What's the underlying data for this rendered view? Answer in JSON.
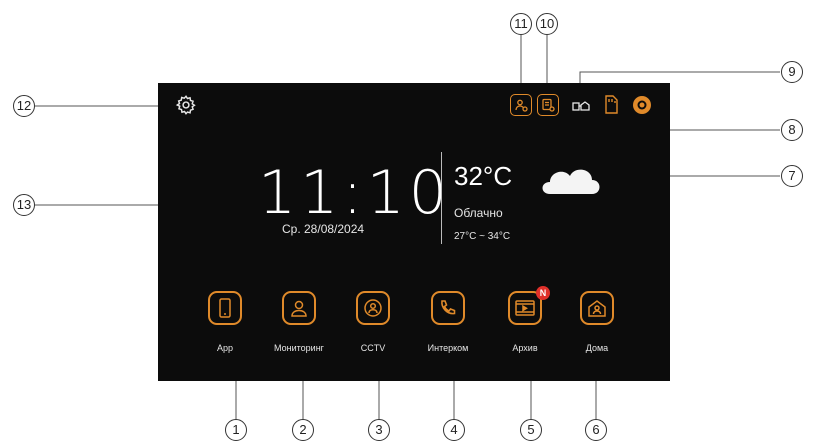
{
  "clock": {
    "time": "11:10",
    "date": "Ср. 28/08/2024"
  },
  "weather": {
    "temperature": "32°C",
    "condition": "Облачно",
    "range": "27°C ~ 34°C",
    "icon": "cloud-icon"
  },
  "apps": [
    {
      "label": "App",
      "icon": "smartphone-icon"
    },
    {
      "label": "Мониторинг",
      "icon": "user-icon"
    },
    {
      "label": "CCTV",
      "icon": "camera-person-icon"
    },
    {
      "label": "Интерком",
      "icon": "phone-icon"
    },
    {
      "label": "Архив",
      "icon": "video-play-icon",
      "badge": "N"
    },
    {
      "label": "Дома",
      "icon": "home-person-icon"
    }
  ],
  "callouts": [
    "1",
    "2",
    "3",
    "4",
    "5",
    "6",
    "7",
    "8",
    "9",
    "10",
    "11",
    "12",
    "13"
  ],
  "colors": {
    "accent": "#e08a2a",
    "screen": "#0c0c0c",
    "badge": "#e0302a",
    "text": "#ffffff"
  }
}
